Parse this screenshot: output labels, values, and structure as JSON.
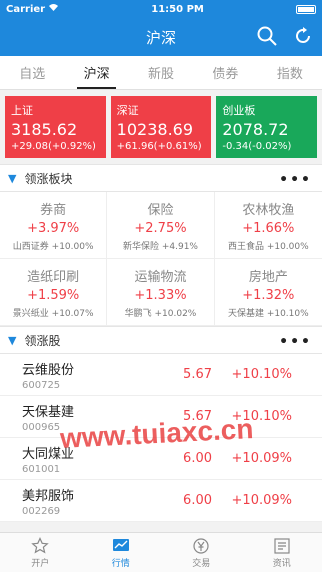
{
  "status": {
    "carrier": "Carrier",
    "time": "11:50 PM"
  },
  "nav": {
    "title": "沪深"
  },
  "tabs": [
    "自选",
    "沪深",
    "新股",
    "债券",
    "指数"
  ],
  "indices": [
    {
      "name": "上证",
      "value": "3185.62",
      "change": "+29.08(+0.92%)",
      "color": "red"
    },
    {
      "name": "深证",
      "value": "10238.69",
      "change": "+61.96(+0.61%)",
      "color": "red"
    },
    {
      "name": "创业板",
      "value": "2078.72",
      "change": "-0.34(-0.02%)",
      "color": "green"
    }
  ],
  "sections": {
    "sectors_title": "领涨板块",
    "stocks_title": "领涨股",
    "more": "•••"
  },
  "sectors": [
    {
      "name": "券商",
      "pct": "+3.97%",
      "sub": "山西证券 +10.00%"
    },
    {
      "name": "保险",
      "pct": "+2.75%",
      "sub": "新华保险 +4.91%"
    },
    {
      "name": "农林牧渔",
      "pct": "+1.66%",
      "sub": "西王食品 +10.00%"
    },
    {
      "name": "造纸印刷",
      "pct": "+1.59%",
      "sub": "景兴纸业 +10.07%"
    },
    {
      "name": "运输物流",
      "pct": "+1.33%",
      "sub": "华鹏飞 +10.02%"
    },
    {
      "name": "房地产",
      "pct": "+1.32%",
      "sub": "天保基建 +10.10%"
    }
  ],
  "stocks": [
    {
      "name": "云维股份",
      "code": "600725",
      "price": "5.67",
      "pct": "+10.10%"
    },
    {
      "name": "天保基建",
      "code": "000965",
      "price": "5.67",
      "pct": "+10.10%"
    },
    {
      "name": "大同煤业",
      "code": "601001",
      "price": "6.00",
      "pct": "+10.09%"
    },
    {
      "name": "美邦服饰",
      "code": "002269",
      "price": "6.00",
      "pct": "+10.09%"
    }
  ],
  "bottom_nav": [
    "开户",
    "行情",
    "交易",
    "资讯"
  ],
  "watermark": "www.tuiaxc.cn"
}
